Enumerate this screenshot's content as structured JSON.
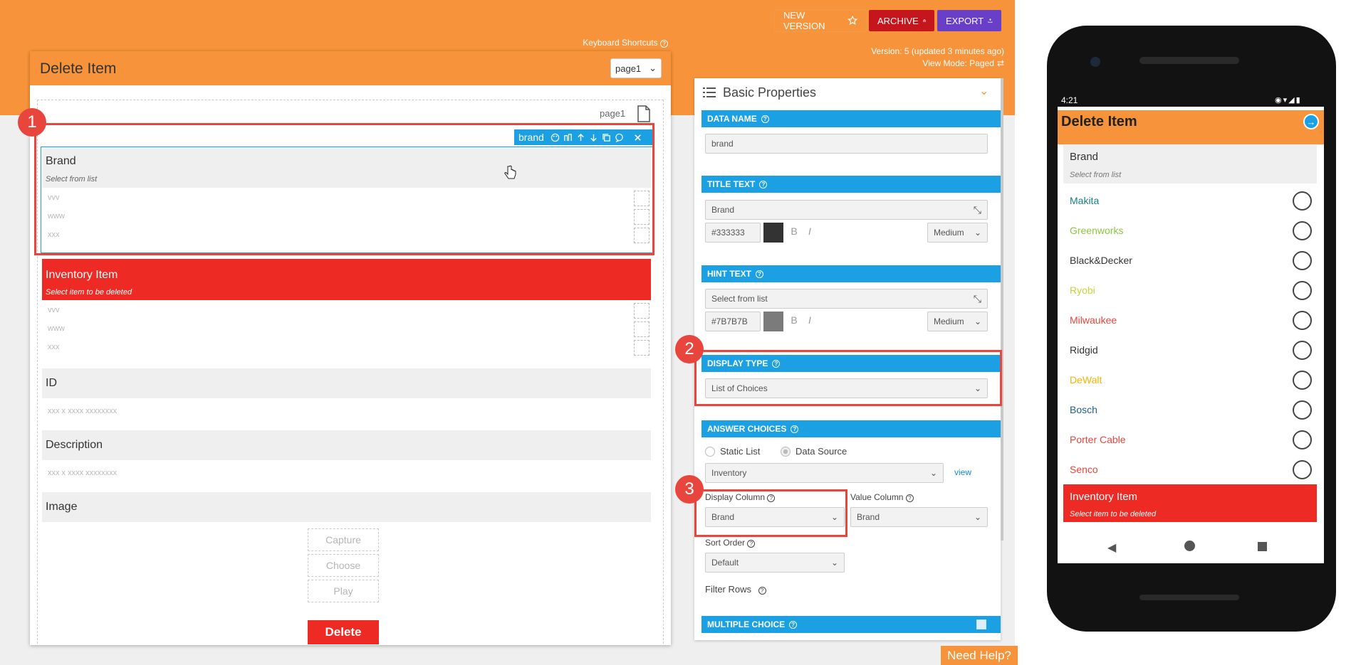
{
  "toolbar": {
    "new_version": "NEW VERSION",
    "archive": "ARCHIVE",
    "export": "EXPORT",
    "keyboard_shortcuts": "Keyboard Shortcuts",
    "version": "Version: 5 (updated 3 minutes ago)",
    "view_mode": "View Mode: Paged"
  },
  "designer": {
    "title": "Delete Item",
    "page_select": "page1",
    "page_label": "page1",
    "brand_toolbar_label": "brand",
    "questions": {
      "brand": {
        "title": "Brand",
        "hint": "Select from list",
        "choices": [
          "vvv",
          "www",
          "xxx"
        ]
      },
      "inventory": {
        "title": "Inventory Item",
        "hint": "Select item to be deleted",
        "choices": [
          "vvv",
          "www",
          "xxx"
        ]
      },
      "id": {
        "title": "ID",
        "placeholder": "xxx x xxxx xxxxxxxx"
      },
      "description": {
        "title": "Description",
        "placeholder": "xxx x xxxx xxxxxxxx"
      },
      "image": {
        "title": "Image",
        "buttons": [
          "Capture",
          "Choose",
          "Play"
        ]
      }
    },
    "delete_button": "Delete"
  },
  "badges": [
    "1",
    "2",
    "3"
  ],
  "properties": {
    "header": "Basic Properties",
    "data_name": {
      "label": "DATA NAME",
      "value": "brand"
    },
    "title_text": {
      "label": "TITLE TEXT",
      "value": "Brand",
      "color": "#333333",
      "size": "Medium"
    },
    "hint_text": {
      "label": "HINT TEXT",
      "value": "Select from list",
      "color": "#7B7B7B",
      "size": "Medium"
    },
    "display_type": {
      "label": "DISPLAY TYPE",
      "value": "List of Choices"
    },
    "answer_choices": {
      "label": "ANSWER CHOICES",
      "static_list": "Static List",
      "data_source": "Data Source",
      "source_value": "Inventory",
      "view_link": "view",
      "display_column_label": "Display Column",
      "display_column_value": "Brand",
      "value_column_label": "Value Column",
      "value_column_value": "Brand",
      "sort_order_label": "Sort Order",
      "sort_order_value": "Default",
      "filter_rows_label": "Filter Rows"
    },
    "multiple_choice": {
      "label": "MULTIPLE CHOICE"
    },
    "bold_label": "B",
    "italic_label": "I"
  },
  "need_help": "Need Help?",
  "phone": {
    "time": "4:21",
    "title": "Delete Item",
    "brand_title": "Brand",
    "brand_hint": "Select from list",
    "items": [
      {
        "label": "Makita",
        "color": "#1a7f8a"
      },
      {
        "label": "Greenworks",
        "color": "#8cc63f"
      },
      {
        "label": "Black&Decker",
        "color": "#333333"
      },
      {
        "label": "Ryobi",
        "color": "#c8d43a"
      },
      {
        "label": "Milwaukee",
        "color": "#e8453c"
      },
      {
        "label": "Ridgid",
        "color": "#333333"
      },
      {
        "label": "DeWalt",
        "color": "#f4b400"
      },
      {
        "label": "Bosch",
        "color": "#1f5f8b"
      },
      {
        "label": "Porter Cable",
        "color": "#e8453c"
      },
      {
        "label": "Senco",
        "color": "#e8453c"
      }
    ],
    "inventory_title": "Inventory Item",
    "inventory_hint": "Select item to be deleted"
  },
  "colors": {
    "accent": "#f7933a",
    "blue": "#1aa0e3",
    "red": "#ee2a24"
  }
}
